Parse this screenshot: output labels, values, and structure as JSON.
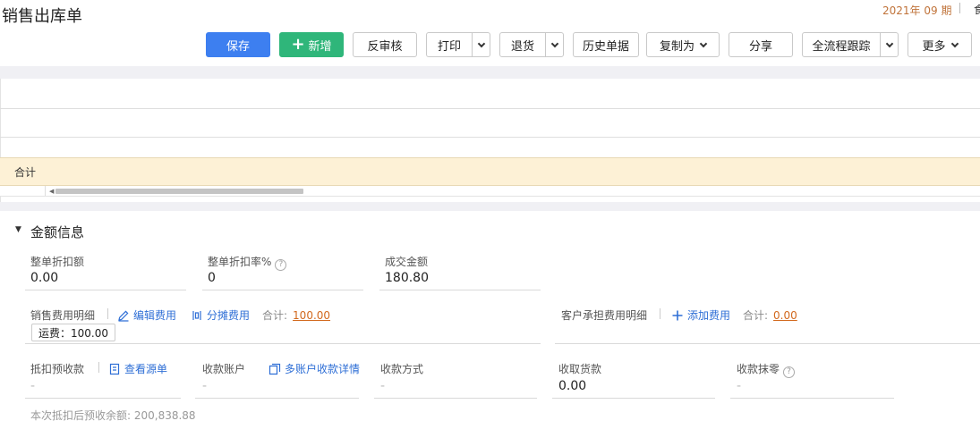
{
  "header": {
    "title": "销售出库单",
    "period": "2021年 09 期",
    "period_tail": "食"
  },
  "toolbar": {
    "save": "保存",
    "add": "新增",
    "unaudit": "反审核",
    "print": "打印",
    "return": "退货",
    "history": "历史单据",
    "copy_as": "复制为",
    "share": "分享",
    "trace": "全流程跟踪",
    "more": "更多"
  },
  "grid": {
    "sum_label": "合计"
  },
  "amount_section": {
    "title": "金额信息",
    "discount_amount": {
      "label": "整单折扣额",
      "value": "0.00"
    },
    "discount_rate": {
      "label": "整单折扣率%",
      "value": "0"
    },
    "deal_amount": {
      "label": "成交金额",
      "value": "180.80"
    },
    "sales_fee": {
      "label": "销售费用明细",
      "edit": "编辑费用",
      "allocate": "分摊费用",
      "total_label": "合计:",
      "total_value": "100.00",
      "tag": "运费：100.00"
    },
    "customer_fee": {
      "label": "客户承担费用明细",
      "add": "添加费用",
      "total_label": "合计:",
      "total_value": "0.00"
    },
    "prepay_deduct": {
      "label": "抵扣预收款",
      "link": "查看源单",
      "value": "-"
    },
    "receive_account": {
      "label": "收款账户",
      "link": "多账户收款详情",
      "value": "-"
    },
    "receive_method": {
      "label": "收款方式",
      "value": "-"
    },
    "receive_amount": {
      "label": "收取货款",
      "value": "0.00"
    },
    "receive_round": {
      "label": "收款抹零",
      "value": "-"
    },
    "footnote": "本次抵扣后预收余额:  200,838.88"
  },
  "colors": {
    "primary": "#3d7ff0",
    "success": "#2fb67a",
    "link": "#2f6fd6",
    "amount": "#d2691e",
    "sum_row": "#fdf1d6"
  }
}
